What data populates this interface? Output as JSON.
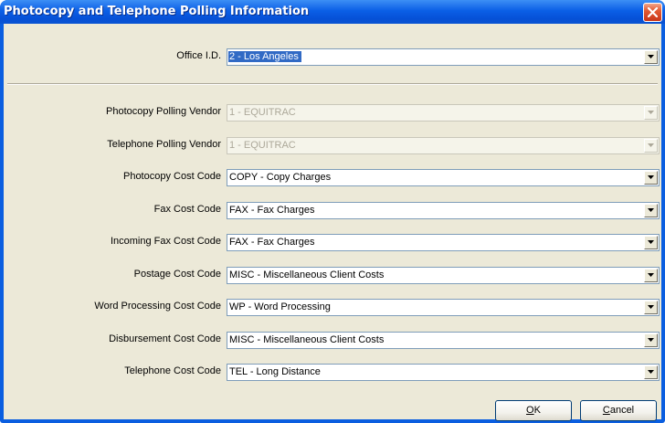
{
  "window": {
    "title": "Photocopy and Telephone Polling Information",
    "close_icon": "close-x-icon"
  },
  "office": {
    "label": "Office I.D.",
    "value": "2 - Los Angeles"
  },
  "fields": [
    {
      "label": "Photocopy Polling Vendor",
      "value": "1 - EQUITRAC",
      "disabled": true
    },
    {
      "label": "Telephone Polling Vendor",
      "value": "1 - EQUITRAC",
      "disabled": true
    },
    {
      "label": "Photocopy Cost Code",
      "value": "COPY - Copy Charges",
      "disabled": false
    },
    {
      "label": "Fax Cost Code",
      "value": "FAX - Fax Charges",
      "disabled": false
    },
    {
      "label": "Incoming Fax Cost Code",
      "value": "FAX - Fax Charges",
      "disabled": false
    },
    {
      "label": "Postage Cost Code",
      "value": "MISC - Miscellaneous Client Costs",
      "disabled": false
    },
    {
      "label": "Word Processing Cost Code",
      "value": "WP - Word Processing",
      "disabled": false
    },
    {
      "label": "Disbursement Cost Code",
      "value": "MISC - Miscellaneous Client Costs",
      "disabled": false
    },
    {
      "label": "Telephone Cost Code",
      "value": "TEL - Long Distance",
      "disabled": false
    }
  ],
  "buttons": {
    "ok": {
      "mnemonic": "O",
      "rest": "K"
    },
    "cancel": {
      "mnemonic": "C",
      "rest": "ancel"
    }
  },
  "colors": {
    "titlebar": "#0b5fe6",
    "dialog_bg": "#ece9d8",
    "selection": "#316ac5",
    "close_button": "#e35a32"
  }
}
